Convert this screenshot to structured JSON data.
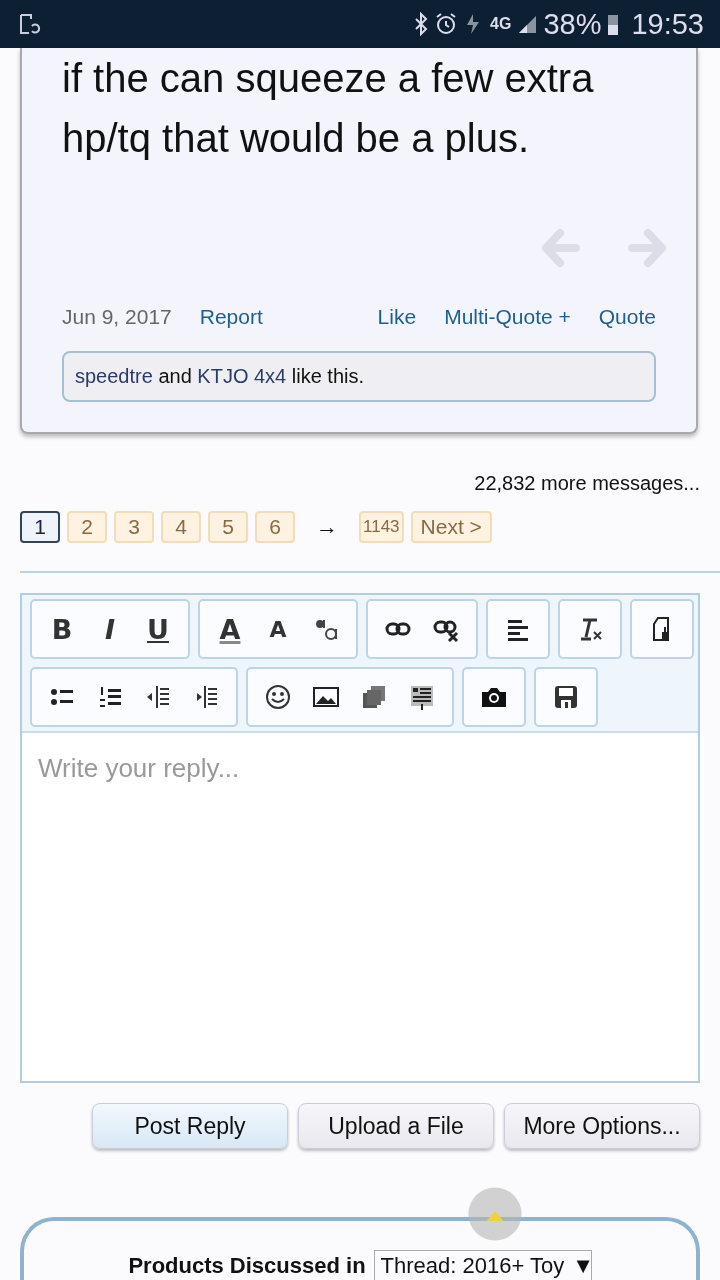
{
  "status_bar": {
    "network": "4G",
    "battery": "38%",
    "time": "19:53"
  },
  "post": {
    "lines": [
      "if the can squeeze a few extra",
      "hp/tq that would be a plus."
    ],
    "date": "Jun 9, 2017",
    "report": "Report",
    "actions": [
      "Like",
      "Multi-Quote +",
      "Quote"
    ],
    "likes": "**speedtre** and **KTJO 4x4** like this."
  },
  "more_messages": "22,832 more messages...",
  "pagination": {
    "pages": [
      {
        "label": "1",
        "selected": true
      },
      {
        "label": "2",
        "selected": false
      },
      {
        "label": "3",
        "selected": false
      },
      {
        "label": "4",
        "selected": false
      },
      {
        "label": "5",
        "selected": false
      },
      {
        "label": "6",
        "selected": false
      }
    ],
    "arrow": "→",
    "last": "1143",
    "next": "Next >"
  },
  "editor": {
    "toolbar": [
      [
        [
          {
            "kind": "bold",
            "glyph": "B"
          },
          {
            "kind": "italic",
            "glyph": "I"
          },
          {
            "kind": "underline",
            "glyph": "U"
          }
        ],
        [
          {
            "kind": "color",
            "glyph": "A"
          },
          {
            "kind": "size",
            "glyph": "A"
          },
          {
            "kind": "translate"
          }
        ],
        [
          {
            "kind": "link"
          },
          {
            "kind": "unlink"
          }
        ],
        [
          {
            "kind": "align"
          }
        ],
        [
          {
            "kind": "clear"
          }
        ],
        [
          {
            "kind": "tool"
          }
        ]
      ],
      [
        [
          {
            "kind": "bullets"
          },
          {
            "kind": "numbers"
          },
          {
            "kind": "outdent"
          },
          {
            "kind": "indent"
          }
        ],
        [
          {
            "kind": "smiley"
          },
          {
            "kind": "image"
          },
          {
            "kind": "media"
          },
          {
            "kind": "code"
          }
        ],
        [
          {
            "kind": "camera"
          }
        ],
        [
          {
            "kind": "save"
          }
        ]
      ]
    ],
    "placeholder": "Write your reply..."
  },
  "buttons": [
    {
      "label": "Post Reply",
      "primary": true
    },
    {
      "label": "Upload a File",
      "primary": false
    },
    {
      "label": "More Options...",
      "primary": false
    }
  ],
  "products": {
    "label": "Products Discussed in",
    "select": "Thread: 2016+ Toy",
    "caret": "▼"
  }
}
